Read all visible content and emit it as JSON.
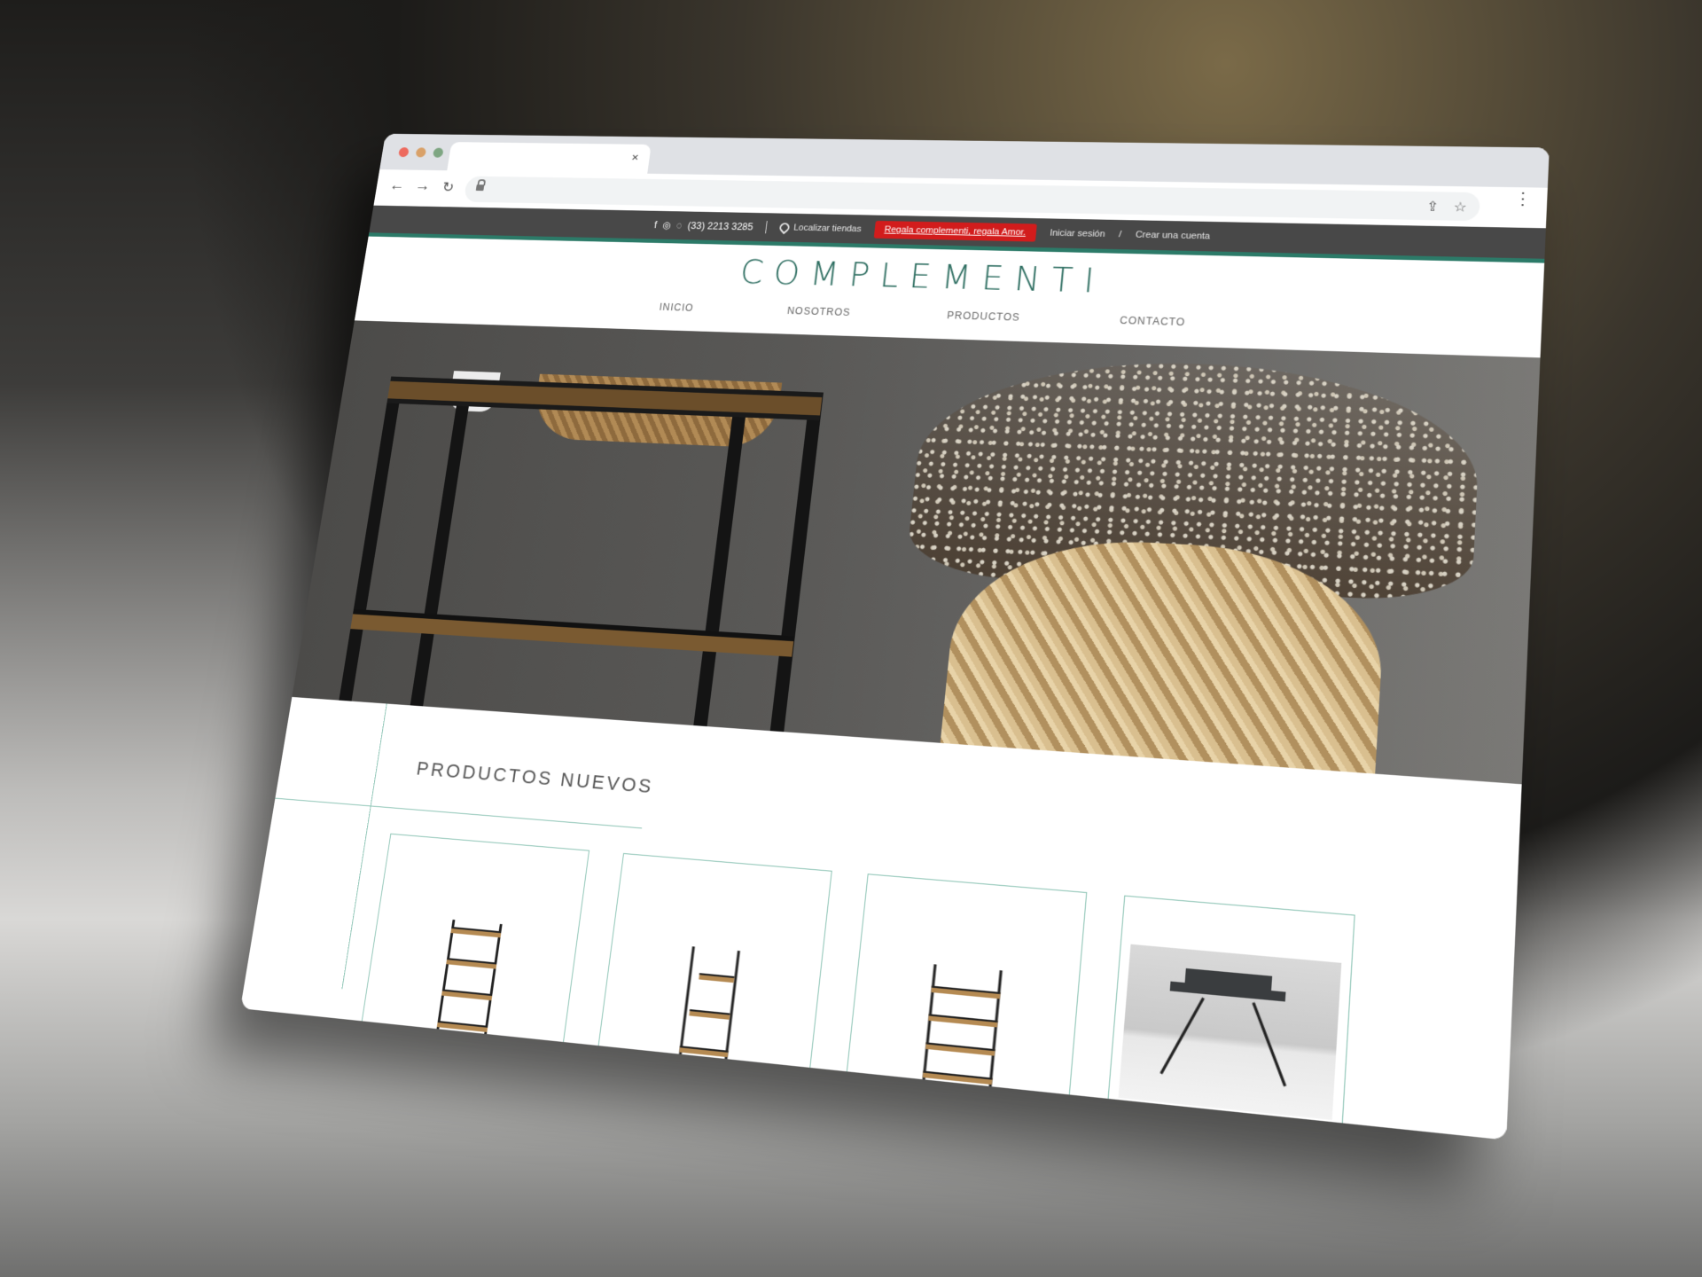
{
  "browser": {
    "tab_close": "×",
    "nav": {
      "back": "←",
      "forward": "→",
      "reload": "↻"
    },
    "actions": {
      "share": "⇪",
      "bookmark": "☆",
      "menu": "⋮"
    }
  },
  "topbar": {
    "social": {
      "facebook": "f",
      "instagram": "◎",
      "whatsapp": "◌"
    },
    "phone": "(33) 2213 3285",
    "locate": "Localizar tiendas",
    "promo": "Regala complementi, regala Amor.",
    "login": "Iniciar sesión",
    "separator": "/",
    "register": "Crear una cuenta"
  },
  "header": {
    "logo": "COMPLEMENTI"
  },
  "nav": {
    "items": [
      {
        "label": "INICIO"
      },
      {
        "label": "NOSOTROS"
      },
      {
        "label": "PRODUCTOS"
      },
      {
        "label": "CONTACTO"
      }
    ]
  },
  "products": {
    "title": "PRODUCTOS NUEVOS",
    "items": [
      {
        "kind": "tower shelf"
      },
      {
        "kind": "ladder shelf"
      },
      {
        "kind": "bookcase shelf"
      },
      {
        "kind": "desk photo"
      }
    ]
  },
  "colors": {
    "accent": "#2c7a68",
    "topbar": "#484848",
    "promo": "#d21c1c",
    "card_border": "#8dc4b5"
  }
}
